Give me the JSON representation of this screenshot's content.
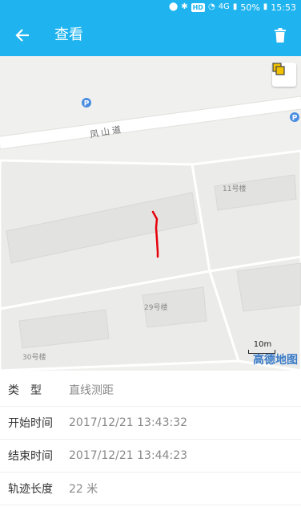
{
  "status_bar": {
    "hd": "HD",
    "network": "4G",
    "battery": "50%",
    "time": "15:53"
  },
  "toolbar": {
    "title": "查看",
    "back_icon": "arrow-left-icon",
    "delete_icon": "trash-icon"
  },
  "colors": {
    "primary": "#1fb4ef",
    "track": "#e8000b",
    "map_bg": "#f0f0ee"
  },
  "map": {
    "road_name": "凤山道",
    "buildings": [
      "11号楼",
      "29号楼",
      "30号楼"
    ],
    "scale_label": "10m",
    "brand": "高德地图"
  },
  "info": {
    "rows": [
      {
        "label": "类型",
        "value": "直线测距"
      },
      {
        "label": "开始时间",
        "value": "2017/12/21 13:43:32"
      },
      {
        "label": "结束时间",
        "value": "2017/12/21 13:44:23"
      },
      {
        "label": "轨迹长度",
        "value": "22 米"
      }
    ]
  }
}
